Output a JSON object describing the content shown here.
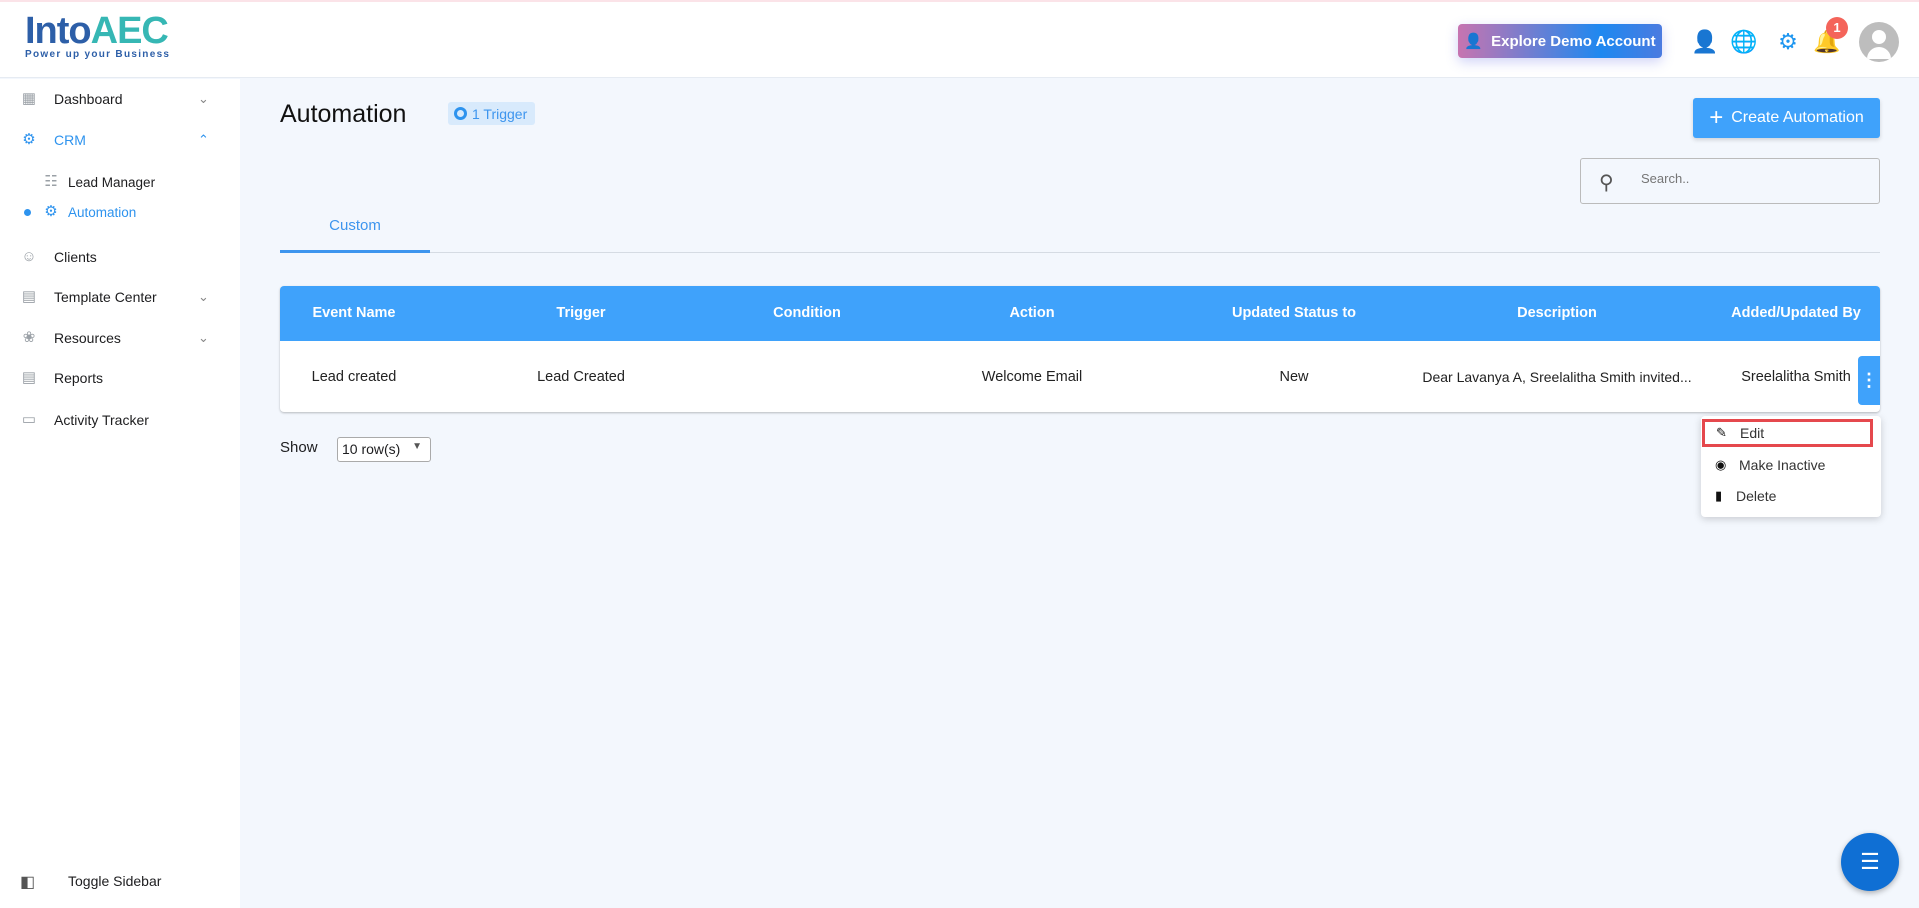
{
  "brand": {
    "name_a": "Into",
    "name_b": "AEC",
    "tagline": "Power up your Business"
  },
  "header": {
    "explore_label": "Explore Demo Account",
    "notification_count": "1",
    "accent": "#1e96f0"
  },
  "sidebar": {
    "items": [
      {
        "label": "Dashboard",
        "icon": "dashboard-icon"
      },
      {
        "label": "CRM",
        "icon": "crm-icon"
      },
      {
        "label": "Lead Manager",
        "icon": "lead-manager-icon"
      },
      {
        "label": "Automation",
        "icon": "automation-icon"
      },
      {
        "label": "Clients",
        "icon": "clients-icon"
      },
      {
        "label": "Template Center",
        "icon": "template-icon"
      },
      {
        "label": "Resources",
        "icon": "resources-icon"
      },
      {
        "label": "Reports",
        "icon": "reports-icon"
      },
      {
        "label": "Activity Tracker",
        "icon": "activity-icon"
      }
    ],
    "toggle_label": "Toggle Sidebar"
  },
  "page": {
    "title": "Automation",
    "trigger_badge": "1 Trigger",
    "create_label": "Create Automation",
    "search_placeholder": "Search..",
    "tab": "Custom"
  },
  "table": {
    "columns": [
      "Event Name",
      "Trigger",
      "Condition",
      "Action",
      "Updated Status to",
      "Description",
      "Added/Updated By"
    ],
    "rows": [
      [
        "Lead created",
        "Lead Created",
        "",
        "Welcome Email",
        "New",
        "Dear Lavanya A, Sreelalitha Smith invited...",
        "Sreelalitha Smith"
      ]
    ]
  },
  "menu": {
    "items": [
      "Edit",
      "Make Inactive",
      "Delete"
    ]
  },
  "pagination": {
    "show_label": "Show",
    "rows_value": "10 row(s)"
  }
}
